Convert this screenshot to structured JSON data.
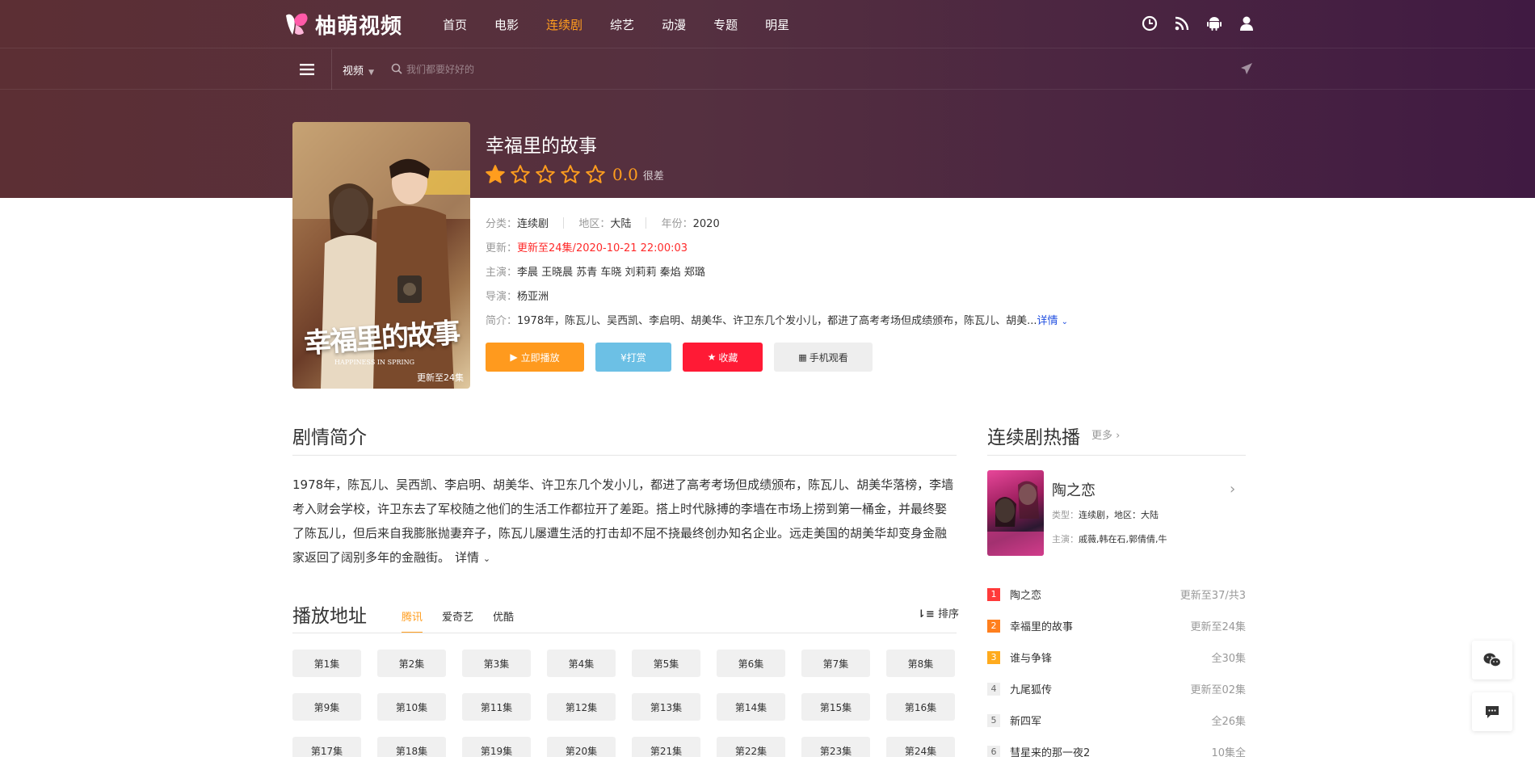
{
  "header": {
    "brand": "柚萌视频",
    "nav": [
      {
        "label": "首页"
      },
      {
        "label": "电影"
      },
      {
        "label": "连续剧",
        "active": true
      },
      {
        "label": "综艺"
      },
      {
        "label": "动漫"
      },
      {
        "label": "专题"
      },
      {
        "label": "明星"
      }
    ],
    "icons": [
      "history-icon",
      "rss-icon",
      "android-icon",
      "user-icon"
    ]
  },
  "search": {
    "category": "视频",
    "placeholder": "我们都要好好的"
  },
  "detail": {
    "title": "幸福里的故事",
    "rating": 0,
    "score": "0.0",
    "score_label": "很差",
    "poster_badge": "更新至24集",
    "poster_title": "幸福里的故事",
    "poster_subtitle": "HAPPINESS IN SPRING",
    "category_label": "分类：",
    "category": "连续剧",
    "region_label": "地区：",
    "region": "大陆",
    "year_label": "年份：",
    "year": "2020",
    "update_label": "更新：",
    "update": "更新至24集/2020-10-21 22:00:03",
    "cast_label": "主演：",
    "cast": "李晨 王晓晨 苏青 车晓 刘莉莉 秦焰 郑璐",
    "director_label": "导演：",
    "director": "杨亚洲",
    "intro_label": "简介：",
    "intro_short": "1978年，陈瓦儿、吴西凯、李启明、胡美华、许卫东几个发小儿，都进了高考考场但成绩颁布，陈瓦儿、胡美...",
    "intro_more": "详情",
    "buttons": {
      "play": "立即播放",
      "donate": "¥打赏",
      "favorite": "收藏",
      "mobile": "手机观看"
    }
  },
  "synopsis": {
    "heading": "剧情简介",
    "text": "1978年，陈瓦儿、吴西凯、李启明、胡美华、许卫东几个发小儿，都进了高考考场但成绩颁布，陈瓦儿、胡美华落榜，李墙考入财会学校，许卫东去了军校随之他们的生活工作都拉开了差距。搭上时代脉搏的李墙在市场上捞到第一桶金，并最终娶了陈瓦儿，但后来自我膨胀抛妻弃子，陈瓦儿屡遭生活的打击却不屈不挠最终创办知名企业。远走美国的胡美华却变身金融家返回了阔别多年的金融街。",
    "more": "详情"
  },
  "playlist": {
    "heading": "播放地址",
    "sources": [
      "腾讯",
      "爱奇艺",
      "优酷"
    ],
    "active_source": 0,
    "sort_label": "排序",
    "episodes": [
      "第1集",
      "第2集",
      "第3集",
      "第4集",
      "第5集",
      "第6集",
      "第7集",
      "第8集",
      "第9集",
      "第10集",
      "第11集",
      "第12集",
      "第13集",
      "第14集",
      "第15集",
      "第16集",
      "第17集",
      "第18集",
      "第19集",
      "第20集",
      "第21集",
      "第22集",
      "第23集",
      "第24集"
    ]
  },
  "sidebar": {
    "heading": "连续剧热播",
    "more": "更多",
    "featured": {
      "title": "陶之恋",
      "type_label": "类型：",
      "type": "连续剧，地区：大陆",
      "cast_label": "主演：",
      "cast": "戚薇,韩在石,郭倩倩,牛"
    },
    "rank": [
      {
        "num": "1",
        "name": "陶之恋",
        "status": "更新至37/共3"
      },
      {
        "num": "2",
        "name": "幸福里的故事",
        "status": "更新至24集"
      },
      {
        "num": "3",
        "name": "谁与争锋",
        "status": "全30集"
      },
      {
        "num": "4",
        "name": "九尾狐传",
        "status": "更新至02集"
      },
      {
        "num": "5",
        "name": "新四军",
        "status": "全26集"
      },
      {
        "num": "6",
        "name": "彗星来的那一夜2",
        "status": "10集全"
      }
    ]
  },
  "colors": {
    "accent": "#ff9d1e",
    "hero_start": "#5c2f34",
    "hero_end": "#401a42",
    "update_red": "#ff2a2a",
    "favorite_red": "#ff1a35",
    "donate_blue": "#6cc0e5"
  }
}
